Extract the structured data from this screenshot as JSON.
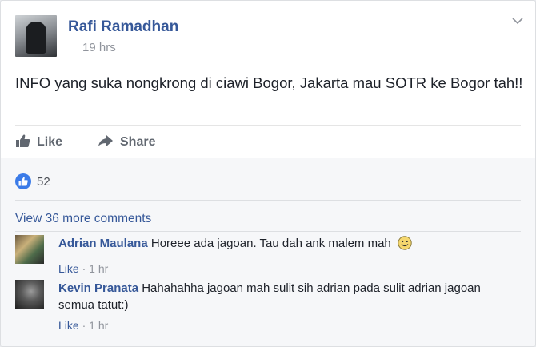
{
  "post": {
    "author": "Rafi Ramadhan",
    "timestamp": "19 hrs",
    "text": "INFO yang suka nongkrong di ciawi Bogor, Jakarta mau SOTR ke Bogor tah!!",
    "chevron_icon": "chevron-down-icon"
  },
  "actions": {
    "like_label": "Like",
    "share_label": "Share"
  },
  "reactions": {
    "count": "52",
    "icon": "thumbs-up-icon",
    "color": "#3b7be8"
  },
  "comments": {
    "view_more": "View 36 more comments",
    "items": [
      {
        "name": "Adrian Maulana",
        "text": "Horeee ada jagoan. Tau dah ank malem mah",
        "emoji": "smiley-icon",
        "like_label": "Like",
        "separator": " · ",
        "time": "1 hr"
      },
      {
        "name": "Kevin Pranata",
        "text": "Hahahahha jagoan mah sulit sih adrian pada sulit adrian jagoan semua tatut:)",
        "like_label": "Like",
        "separator": " · ",
        "time": "1 hr"
      }
    ]
  },
  "colors": {
    "link": "#365899",
    "meta": "#90949c",
    "text": "#1d2129"
  }
}
